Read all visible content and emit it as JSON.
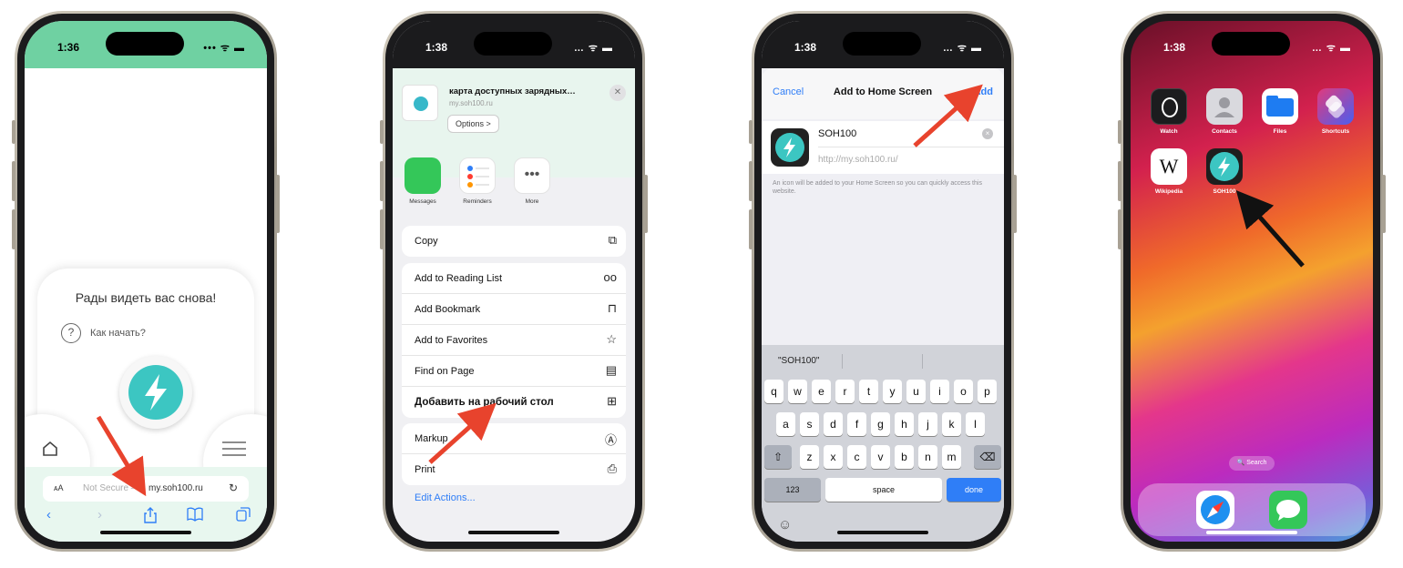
{
  "colors": {
    "ios_blue": "#2f7ef7",
    "accent_teal": "#3cc6c2",
    "arrow_red": "#e8432d",
    "arrow_black": "#111111",
    "header_green": "#6fd1a2"
  },
  "phone1": {
    "time": "1:36",
    "greeting": "Рады видеть вас снова!",
    "help_icon": "?",
    "help_text": "Как начать?",
    "url_aa": "ᴀA",
    "url_not_secure": "Not Secure —",
    "url_domain": "my.soh100.ru",
    "icons": [
      "home-icon",
      "menu-icon",
      "reload-icon",
      "back-icon",
      "forward-icon",
      "share-icon",
      "bookmarks-icon",
      "tabs-icon",
      "bolt-logo-icon"
    ]
  },
  "phone2": {
    "time": "1:38",
    "preview_title": "карта доступных зарядных…",
    "preview_url": "my.soh100.ru",
    "options_label": "Options >",
    "close": "✕",
    "apps": [
      {
        "label": "Messages",
        "icon": "messages-icon",
        "color": "#34c759"
      },
      {
        "label": "Reminders",
        "icon": "reminders-icon",
        "color": "#ffffff"
      },
      {
        "label": "More",
        "icon": "more-icon",
        "color": "#ffffff"
      }
    ],
    "groups": [
      [
        {
          "label": "Copy",
          "icon": "copy-icon"
        }
      ],
      [
        {
          "label": "Add to Reading List",
          "icon": "glasses-icon"
        },
        {
          "label": "Add Bookmark",
          "icon": "book-icon"
        },
        {
          "label": "Add to Favorites",
          "icon": "star-icon"
        },
        {
          "label": "Find on Page",
          "icon": "find-icon"
        },
        {
          "label": "Добавить на рабочий стол",
          "icon": "add-square-icon"
        }
      ],
      [
        {
          "label": "Markup",
          "icon": "markup-icon"
        },
        {
          "label": "Print",
          "icon": "printer-icon"
        }
      ]
    ],
    "edit_actions": "Edit Actions..."
  },
  "phone3": {
    "time": "1:38",
    "cancel": "Cancel",
    "title": "Add to Home Screen",
    "add": "Add",
    "name": "SOH100",
    "url": "http://my.soh100.ru/",
    "note": "An icon will be added to your Home Screen so you can quickly access this website.",
    "suggestion": "\"SOH100\"",
    "row1": [
      "q",
      "w",
      "e",
      "r",
      "t",
      "y",
      "u",
      "i",
      "o",
      "p"
    ],
    "row2": [
      "a",
      "s",
      "d",
      "f",
      "g",
      "h",
      "j",
      "k",
      "l"
    ],
    "row3": [
      "z",
      "x",
      "c",
      "v",
      "b",
      "n",
      "m"
    ],
    "shift": "⇧",
    "backspace": "⌫",
    "num": "123",
    "space": "space",
    "done": "done",
    "emoji": "☺"
  },
  "phone4": {
    "time": "1:38",
    "apps": [
      {
        "label": "Watch",
        "icon": "watch-icon",
        "color": "#1c1c1e"
      },
      {
        "label": "Contacts",
        "icon": "contacts-icon",
        "color": "#d9d9de"
      },
      {
        "label": "Files",
        "icon": "files-icon",
        "color": "#1e7cf2"
      },
      {
        "label": "Shortcuts",
        "icon": "shortcuts-icon",
        "color": "#7b3fe4"
      },
      {
        "label": "Wikipedia",
        "icon": "wikipedia-icon",
        "color": "#ffffff",
        "glyph": "W"
      },
      {
        "label": "SOH100",
        "icon": "soh100-icon",
        "color": "#1e1e1e"
      }
    ],
    "search": "🔍 Search",
    "dock": [
      {
        "icon": "safari-icon",
        "color": "#ffffff"
      },
      {
        "icon": "messages-icon",
        "color": "#34c759"
      }
    ]
  }
}
